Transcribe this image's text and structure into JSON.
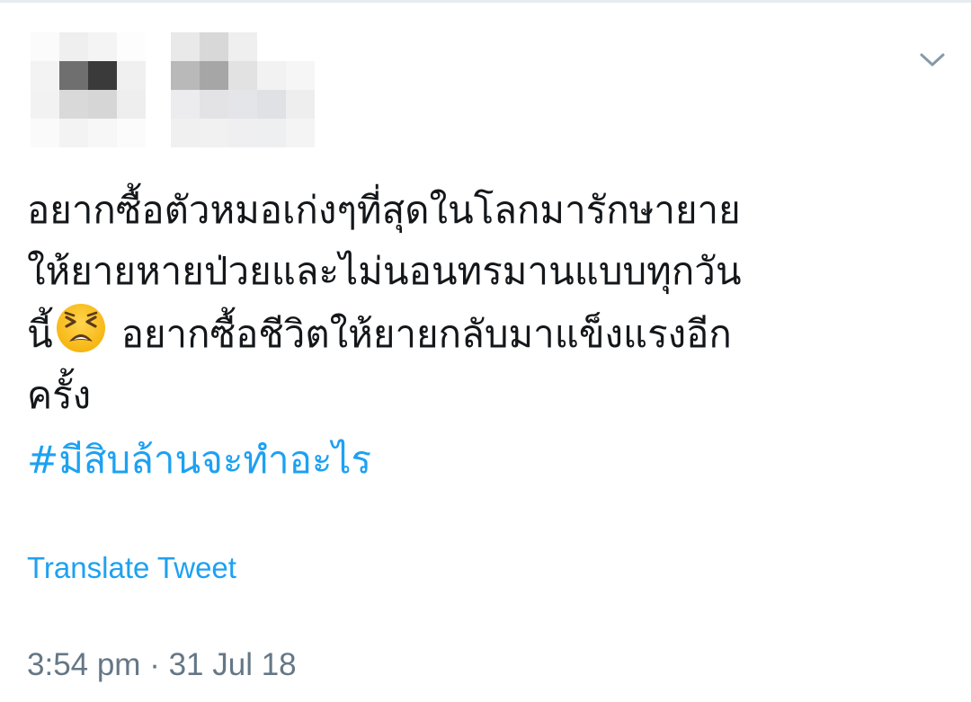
{
  "tweet": {
    "text_lines": [
      "อยากซื้อตัวหมอเก่งๆที่สุดในโลกมารักษายาย",
      "ให้ยายหายป่วยและไม่นอนทรมานแบบทุกวัน",
      "นี้",
      "อยากซื้อชีวิตให้ยายกลับมาแข็งแรงอีก",
      "ครั้ง"
    ],
    "emoji": "tired-face-emoji",
    "hashtag": "#มีสิบล้านจะทำอะไร",
    "translate_label": "Translate Tweet",
    "time": "3:54 pm",
    "separator": "·",
    "date": "31 Jul 18"
  },
  "header": {
    "avatar_state": "pixelated",
    "username_state": "pixelated",
    "menu_icon": "chevron-down-icon"
  },
  "colors": {
    "text": "#14171a",
    "link": "#1da1f2",
    "meta": "#657786",
    "chevron": "#8899a6"
  }
}
